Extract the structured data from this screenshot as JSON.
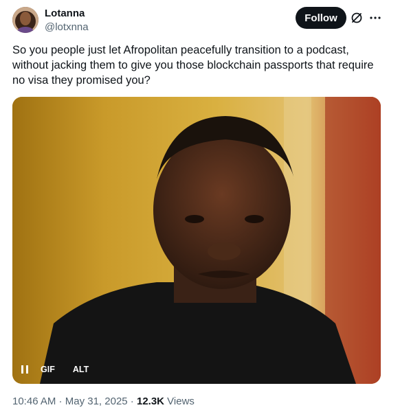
{
  "user": {
    "display_name": "Lotanna",
    "handle": "@lotxnna"
  },
  "header": {
    "follow_label": "Follow",
    "icons": [
      "grok-icon",
      "more-icon"
    ]
  },
  "tweet": {
    "text": "So you people just let Afropolitan peacefully transition to a podcast,\nwithout jacking them to give you those blockchain passports that require\nno visa they promised you?"
  },
  "media": {
    "gif_label": "GIF",
    "alt_label": "ALT",
    "pause_icon": "pause-icon"
  },
  "meta": {
    "time": "10:46 AM",
    "sep1": " · ",
    "date": "May 31, 2025",
    "sep2": " · ",
    "views_count": "12.3K",
    "views_label": " Views"
  },
  "colors": {
    "follow_bg": "#0f1419",
    "secondary_text": "#536471",
    "primary_text": "#0f1419"
  }
}
